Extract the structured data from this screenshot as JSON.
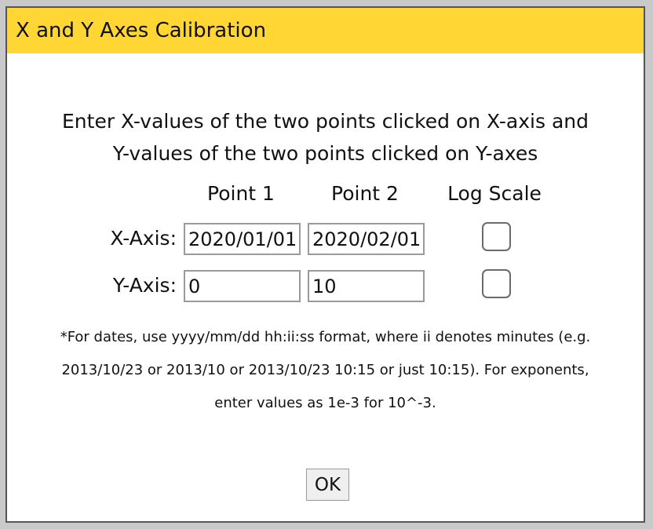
{
  "dialog": {
    "title": "X and Y Axes Calibration",
    "instructions_line1": "Enter X-values of the two points clicked on X-axis and",
    "instructions_line2": "Y-values of the two points clicked on Y-axes",
    "columns": {
      "point1": "Point 1",
      "point2": "Point 2",
      "log_scale": "Log Scale"
    },
    "x_axis": {
      "label": "X-Axis:",
      "point1_value": "2020/01/01",
      "point2_value": "2020/02/01",
      "log_scale_checked": false
    },
    "y_axis": {
      "label": "Y-Axis:",
      "point1_value": "0",
      "point2_value": "10",
      "log_scale_checked": false
    },
    "note_line1": "*For dates, use yyyy/mm/dd hh:ii:ss format, where ii denotes minutes (e.g.",
    "note_line2": "2013/10/23 or 2013/10 or 2013/10/23 10:15 or just 10:15). For exponents,",
    "note_line3": "enter values as 1e-3 for 10^-3.",
    "ok_label": "OK"
  },
  "colors": {
    "titlebar": "#ffd633",
    "border": "#555555"
  }
}
